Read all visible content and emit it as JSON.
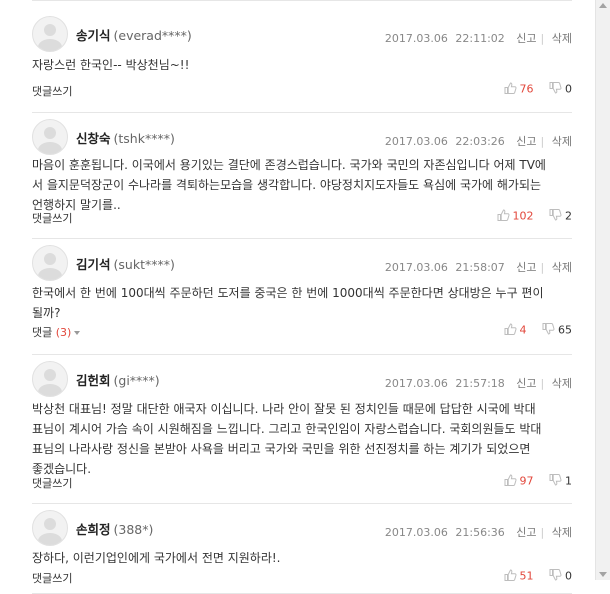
{
  "comments": [
    {
      "author": "송기식",
      "userid": "(everad****)",
      "date": "2017.03.06",
      "time": "22:11:02",
      "report": "신고",
      "delete": "삭제",
      "lines": [
        "자랑스런 한국인-- 박상천님~!!"
      ],
      "reply_label": "댓글쓰기",
      "reply_count": "",
      "likes": "76",
      "dislikes": "0"
    },
    {
      "author": "신창숙",
      "userid": "(tshk****)",
      "date": "2017.03.06",
      "time": "22:03:26",
      "report": "신고",
      "delete": "삭제",
      "lines": [
        "마음이 훈훈됩니다. 이국에서 용기있는 결단에 존경스럽습니다. 국가와 국민의 자존심입니다 어제 TV에",
        "서 을지문덕장군이 수나라를 격퇴하는모습을 생각합니다. 야당정치지도자들도 욕심에 국가에 해가되는",
        "언행하지 말기를.."
      ],
      "reply_label": "댓글쓰기",
      "reply_count": "",
      "likes": "102",
      "dislikes": "2"
    },
    {
      "author": "김기석",
      "userid": "(sukt****)",
      "date": "2017.03.06",
      "time": "21:58:07",
      "report": "신고",
      "delete": "삭제",
      "lines": [
        "한국에서 한 번에 100대씩 주문하던 도저를 중국은 한 번에 1000대씩 주문한다면 상대방은 누구 편이",
        "될까?"
      ],
      "reply_label": "댓글",
      "reply_count": "(3)",
      "likes": "4",
      "dislikes": "65"
    },
    {
      "author": "김헌회",
      "userid": "(gi****)",
      "date": "2017.03.06",
      "time": "21:57:18",
      "report": "신고",
      "delete": "삭제",
      "lines": [
        "박상천 대표님! 정말 대단한 애국자 이십니다. 나라 안이 잘못 된 정치인들 때문에 답답한 시국에 박대",
        "표님이 계시어 가슴 속이 시원해짐을 느낍니다. 그리고 한국인임이 자랑스럽습니다. 국회의원들도 박대",
        "표님의 나라사랑 정신을 본받아 사욕을 버리고 국가와 국민을 위한 선진정치를 하는 계기가 되었으면",
        "좋겠습니다."
      ],
      "reply_label": "댓글쓰기",
      "reply_count": "",
      "likes": "97",
      "dislikes": "1"
    },
    {
      "author": "손희정",
      "userid": "(388*)",
      "date": "2017.03.06",
      "time": "21:56:36",
      "report": "신고",
      "delete": "삭제",
      "lines": [
        "장하다, 이런기업인에게 국가에서 전면 지원하라!."
      ],
      "reply_label": "댓글쓰기",
      "reply_count": "",
      "likes": "51",
      "dislikes": "0"
    }
  ],
  "colors": {
    "accent": "#e2473b",
    "text": "#333333",
    "muted": "#888888",
    "divider": "#e6e6e6"
  },
  "icons": {
    "like": "thumbs-up-icon",
    "dislike": "thumbs-down-icon",
    "avatar": "default-user-avatar"
  }
}
